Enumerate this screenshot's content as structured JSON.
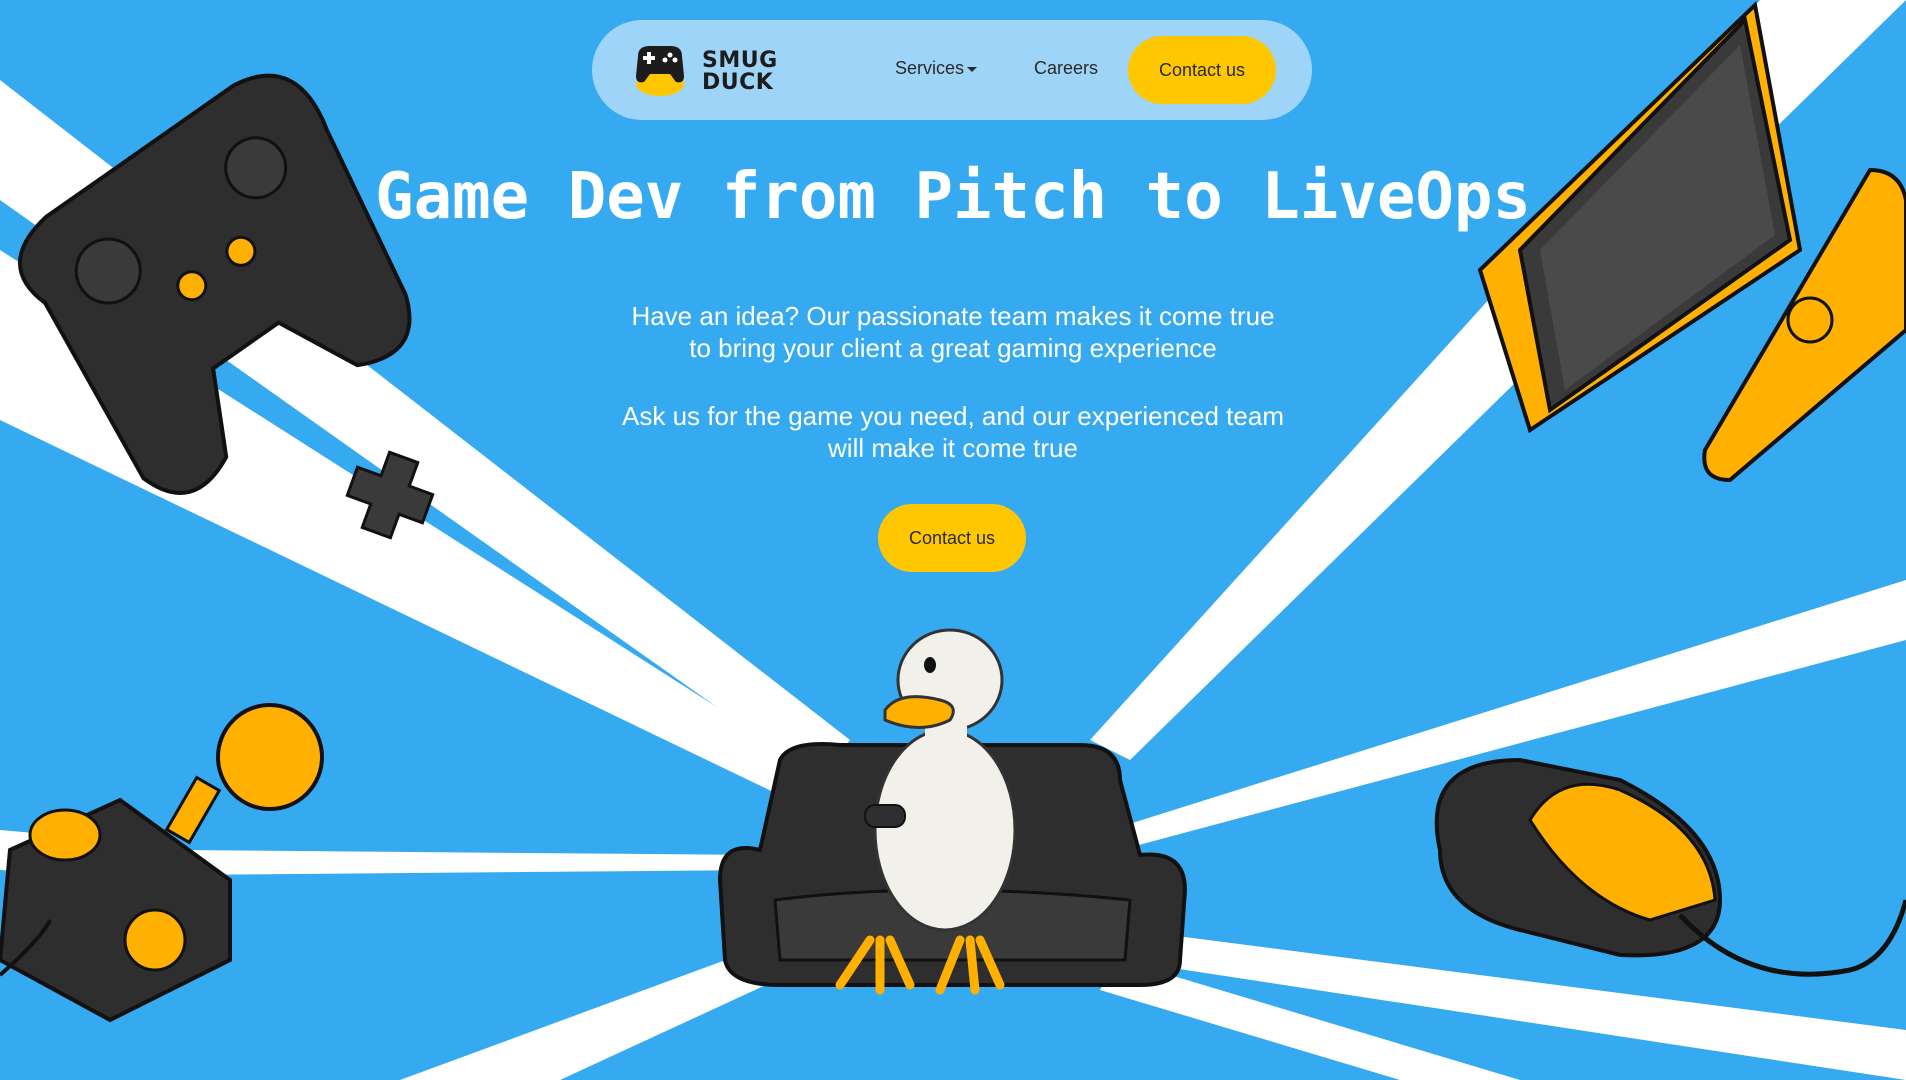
{
  "brand": {
    "logo_line1": "SMUG",
    "logo_line2": "DUCK"
  },
  "nav": {
    "services_label": "Services",
    "careers_label": "Careers",
    "contact_label": "Contact us"
  },
  "hero": {
    "title": "Game Dev from Pitch to LiveOps",
    "paragraph1_line1": "Have an idea? Our passionate team makes it come true",
    "paragraph1_line2": "to bring your client a great gaming experience",
    "paragraph2_line1": "Ask us for the game you need, and our experienced team",
    "paragraph2_line2": "will make it come true",
    "cta_label": "Contact us"
  },
  "colors": {
    "background": "#36aaf0",
    "nav_background": "#9dd4f7",
    "accent_yellow": "#ffc700",
    "dark_gray": "#2e2e2e",
    "white": "#ffffff"
  },
  "icons": [
    "gamepad-icon",
    "dpad-icon",
    "joystick-icon",
    "console-switch-icon",
    "mouse-icon",
    "duck-mascot"
  ]
}
